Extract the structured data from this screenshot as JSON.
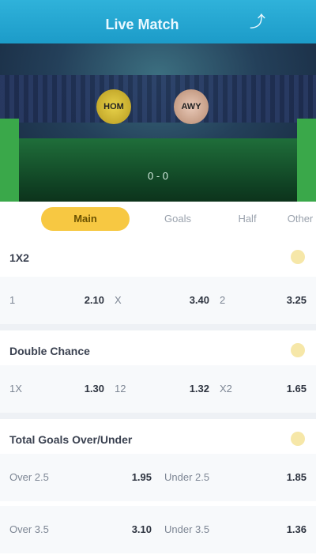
{
  "header": {
    "title": "Live Match",
    "share_icon": "share-icon"
  },
  "match": {
    "home_short": "HOM",
    "away_short": "AWY",
    "score": "0 - 0",
    "home_color": "#e8d24a",
    "away_color": "#e9c9b8"
  },
  "tabs": [
    {
      "label": "Main",
      "active": true
    },
    {
      "label": "Goals",
      "active": false
    },
    {
      "label": "Half",
      "active": false
    },
    {
      "label": "Other",
      "active": false
    }
  ],
  "markets": [
    {
      "name": "1X2",
      "odds": [
        {
          "label": "1",
          "value": "2.10"
        },
        {
          "label": "X",
          "value": "3.40"
        },
        {
          "label": "2",
          "value": "3.25"
        }
      ]
    },
    {
      "name": "Double Chance",
      "odds": [
        {
          "label": "1X",
          "value": "1.30"
        },
        {
          "label": "12",
          "value": "1.32"
        },
        {
          "label": "X2",
          "value": "1.65"
        }
      ]
    },
    {
      "name": "Total Goals Over/Under",
      "odds": [
        {
          "label": "Over 2.5",
          "value": "1.95"
        },
        {
          "label": "Under 2.5",
          "value": "1.85"
        },
        {
          "label": "Over 3.5",
          "value": "3.10"
        },
        {
          "label": "Under 3.5",
          "value": "1.36"
        }
      ]
    }
  ],
  "colors": {
    "header": "#1fa3cf",
    "active_tab": "#f7c842",
    "background": "#f3f5f8"
  }
}
